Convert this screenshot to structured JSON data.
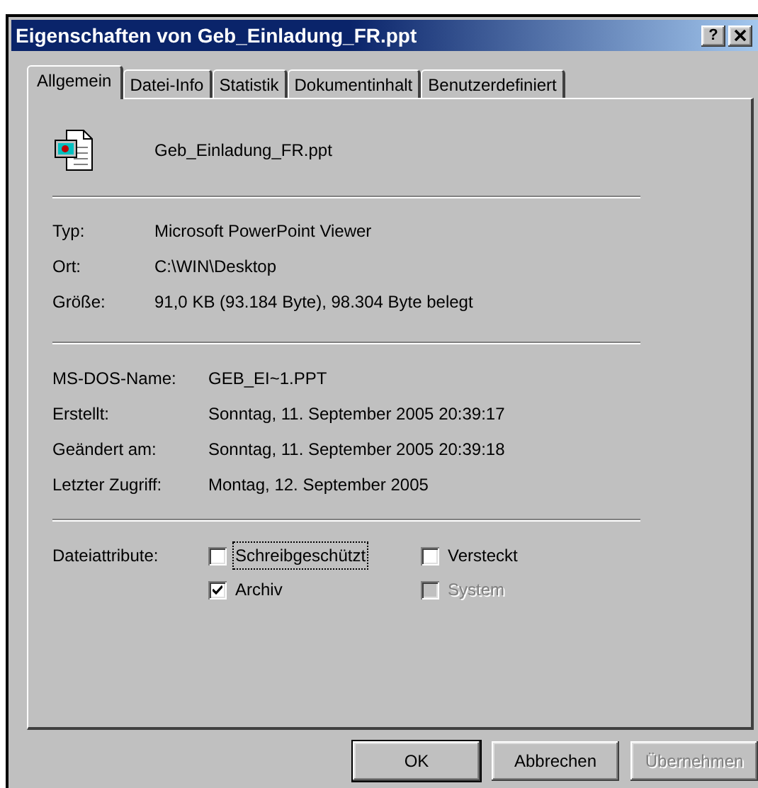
{
  "window": {
    "title": "Eigenschaften von Geb_Einladung_FR.ppt",
    "help_button": "?"
  },
  "tabs": [
    {
      "label": "Allgemein",
      "selected": true
    },
    {
      "label": "Datei-Info",
      "selected": false
    },
    {
      "label": "Statistik",
      "selected": false
    },
    {
      "label": "Dokumentinhalt",
      "selected": false
    },
    {
      "label": "Benutzerdefiniert",
      "selected": false
    }
  ],
  "file_name": "Geb_Einladung_FR.ppt",
  "location_info": [
    {
      "label": "Typ:",
      "value": "Microsoft PowerPoint Viewer"
    },
    {
      "label": "Ort:",
      "value": "C:\\WIN\\Desktop"
    },
    {
      "label": "Größe:",
      "value": "91,0 KB (93.184 Byte), 98.304 Byte belegt"
    }
  ],
  "date_info": [
    {
      "label": "MS-DOS-Name:",
      "value": "GEB_EI~1.PPT"
    },
    {
      "label": "Erstellt:",
      "value": "Sonntag, 11. September 2005 20:39:17"
    },
    {
      "label": "Geändert am:",
      "value": "Sonntag, 11. September 2005 20:39:18"
    },
    {
      "label": "Letzter Zugriff:",
      "value": "Montag, 12. September 2005"
    }
  ],
  "attributes": {
    "label": "Dateiattribute:",
    "checkboxes": [
      {
        "label": "Schreibgeschützt",
        "checked": false,
        "disabled": false,
        "focused": true
      },
      {
        "label": "Versteckt",
        "checked": false,
        "disabled": false,
        "focused": false
      },
      {
        "label": "Archiv",
        "checked": true,
        "disabled": false,
        "focused": false
      },
      {
        "label": "System",
        "checked": false,
        "disabled": true,
        "focused": false
      }
    ]
  },
  "buttons": [
    {
      "label": "OK",
      "default": true,
      "disabled": false
    },
    {
      "label": "Abbrechen",
      "default": false,
      "disabled": false
    },
    {
      "label": "Übernehmen",
      "default": false,
      "disabled": true
    }
  ]
}
